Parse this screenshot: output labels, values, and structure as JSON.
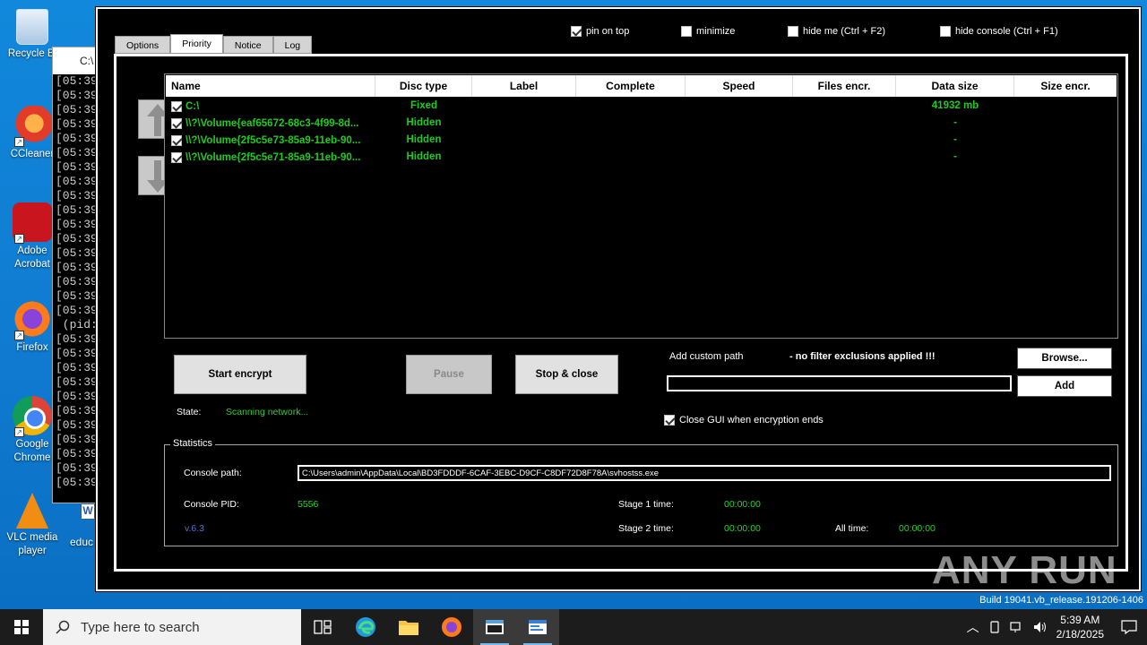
{
  "desktop": {
    "icons": [
      {
        "label": "Recycle Bi",
        "icon": "recycle-bin-icon"
      },
      {
        "label": "CCleaner",
        "icon": "ccleaner-icon"
      },
      {
        "label": "Adobe Acrobat",
        "icon": "adobe-acrobat-icon"
      },
      {
        "label": "Firefox",
        "icon": "firefox-icon"
      },
      {
        "label": "Google Chrome",
        "icon": "chrome-icon"
      },
      {
        "label": "VLC media player",
        "icon": "vlc-icon"
      }
    ],
    "misc_label": "educ",
    "console_title": "C:\\",
    "console_lines": [
      "[05:39",
      "[05:39",
      "[05:39",
      "[05:39",
      "[05:39",
      "[05:39",
      "[05:39",
      "[05:39",
      "[05:39",
      "[05:39",
      "[05:39",
      "[05:39",
      "[05:39",
      "[05:39",
      "[05:39",
      "[05:39",
      "[05:39",
      " (pid:",
      "[05:39",
      "[05:39",
      "[05:39",
      "[05:39",
      "[05:39",
      "[05:39",
      "[05:39",
      "[05:39",
      "[05:39",
      "[05:39",
      "[05:39"
    ]
  },
  "app": {
    "tabs": [
      "Options",
      "Priority",
      "Notice",
      "Log"
    ],
    "active_tab": "Priority",
    "top_options": [
      {
        "label": "pin on top",
        "checked": true
      },
      {
        "label": "minimize",
        "checked": false
      },
      {
        "label": "hide me (Ctrl + F2)",
        "checked": false
      },
      {
        "label": "hide console (Ctrl + F1)",
        "checked": false
      }
    ],
    "table": {
      "columns": [
        "Name",
        "Disc type",
        "Label",
        "Complete",
        "Speed",
        "Files encr.",
        "Data size",
        "Size encr."
      ],
      "rows": [
        {
          "name": "C:\\",
          "disc_type": "Fixed",
          "label": "",
          "complete": "",
          "speed": "",
          "files": "",
          "data_size": "41932 mb",
          "size_encr": ""
        },
        {
          "name": "\\\\?\\Volume{eaf65672-68c3-4f99-8d...",
          "disc_type": "Hidden",
          "label": "",
          "complete": "",
          "speed": "",
          "files": "",
          "data_size": "-",
          "size_encr": ""
        },
        {
          "name": "\\\\?\\Volume{2f5c5e73-85a9-11eb-90...",
          "disc_type": "Hidden",
          "label": "",
          "complete": "",
          "speed": "",
          "files": "",
          "data_size": "-",
          "size_encr": ""
        },
        {
          "name": "\\\\?\\Volume{2f5c5e71-85a9-11eb-90...",
          "disc_type": "Hidden",
          "label": "",
          "complete": "",
          "speed": "",
          "files": "",
          "data_size": "-",
          "size_encr": ""
        }
      ]
    },
    "buttons": {
      "start": "Start encrypt",
      "pause": "Pause",
      "stop": "Stop & close",
      "browse": "Browse...",
      "add": "Add"
    },
    "custom_path": {
      "label": "Add custom path",
      "notice": "- no filter exclusions applied !!!",
      "value": ""
    },
    "close_gui": {
      "label": "Close GUI when encryption ends",
      "checked": true
    },
    "state": {
      "label": "State:",
      "value": "Scanning network..."
    },
    "statistics": {
      "legend": "Statistics",
      "console_path_label": "Console path:",
      "console_path": "C:\\Users\\admin\\AppData\\Local\\BD3FDDDF-6CAF-3EBC-D9CF-C8DF72D8F78A\\svhostss.exe",
      "console_pid_label": "Console PID:",
      "console_pid": "5556",
      "version": "v.6.3",
      "stage1_label": "Stage 1 time:",
      "stage1": "00:00:00",
      "stage2_label": "Stage 2 time:",
      "stage2": "00:00:00",
      "all_label": "All time:",
      "all": "00:00:00"
    }
  },
  "watermark": "ANY RUN",
  "build": "Build 19041.vb_release.191206-1406",
  "taskbar": {
    "search_placeholder": "Type here to search",
    "time": "5:39 AM",
    "date": "2/18/2025"
  },
  "colors": {
    "desktop": "#0f7ad0",
    "status_green": "#2bd12b",
    "version_blue": "#5a6fd0"
  }
}
